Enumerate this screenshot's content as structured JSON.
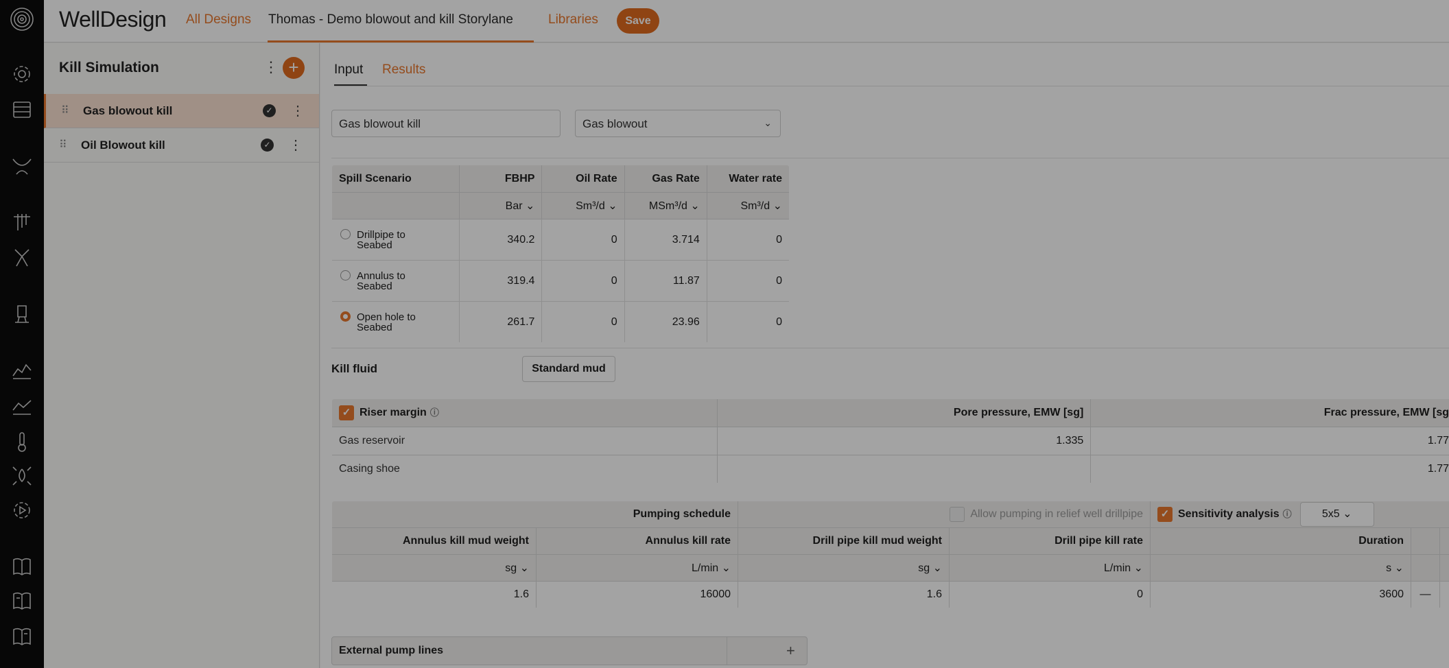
{
  "topbar": {
    "brand": "WellDesign",
    "nav_all_designs": "All Designs",
    "project_title": "Thomas - Demo blowout and kill Storylane",
    "nav_libraries": "Libraries",
    "save_label": "Save"
  },
  "rail_icons": [
    "logo-icon",
    "settings-icon",
    "layers-icon",
    "trajectory-icon",
    "casing-icon",
    "branches-icon",
    "rig-icon",
    "area-chart-icon",
    "line-chart-icon",
    "thermometer-icon",
    "drop-icon",
    "play-settings-icon",
    "book-icon",
    "book-alt-icon",
    "book-third-icon"
  ],
  "sidebar": {
    "title": "Kill Simulation",
    "items": [
      {
        "label": "Gas blowout kill",
        "active": true
      },
      {
        "label": "Oil Blowout kill",
        "active": false
      }
    ]
  },
  "main": {
    "tabs": {
      "input": "Input",
      "results": "Results"
    },
    "name_field": "Gas blowout kill",
    "type_select": "Gas blowout",
    "spill": {
      "headers": [
        "Spill Scenario",
        "FBHP",
        "Oil Rate",
        "Gas Rate",
        "Water rate"
      ],
      "units": [
        "",
        "Bar",
        "Sm³/d",
        "MSm³/d",
        "Sm³/d"
      ],
      "rows": [
        {
          "scenario_l1": "Drillpipe to",
          "scenario_l2": "Seabed",
          "fbhp": "340.2",
          "oil": "0",
          "gas": "3.714",
          "water": "0",
          "selected": false
        },
        {
          "scenario_l1": "Annulus to",
          "scenario_l2": "Seabed",
          "fbhp": "319.4",
          "oil": "0",
          "gas": "11.87",
          "water": "0",
          "selected": false
        },
        {
          "scenario_l1": "Open hole to",
          "scenario_l2": "Seabed",
          "fbhp": "261.7",
          "oil": "0",
          "gas": "23.96",
          "water": "0",
          "selected": true
        }
      ]
    },
    "kill_fluid": {
      "label": "Kill fluid",
      "value": "Standard mud"
    },
    "riser": {
      "checkbox_label": "Riser margin",
      "pore_header": "Pore pressure, EMW [sg]",
      "frac_header": "Frac pressure, EMW [sg",
      "rows": [
        {
          "name": "Gas reservoir",
          "pore": "1.335",
          "frac": "1.77"
        },
        {
          "name": "Casing shoe",
          "pore": "",
          "frac": "1.77"
        }
      ]
    },
    "pumping": {
      "schedule_label": "Pumping schedule",
      "allow_label": "Allow pumping in relief well drillpipe",
      "sensitivity_label": "Sensitivity analysis",
      "sensitivity_value": "5x5",
      "headers": [
        "Annulus kill mud weight",
        "Annulus kill rate",
        "Drill pipe kill mud weight",
        "Drill pipe kill rate",
        "Duration"
      ],
      "units": [
        "sg",
        "L/min",
        "sg",
        "L/min",
        "s"
      ],
      "values": [
        "1.6",
        "16000",
        "1.6",
        "0",
        "3600"
      ],
      "dash": "—"
    },
    "external": {
      "label": "External pump lines"
    }
  }
}
